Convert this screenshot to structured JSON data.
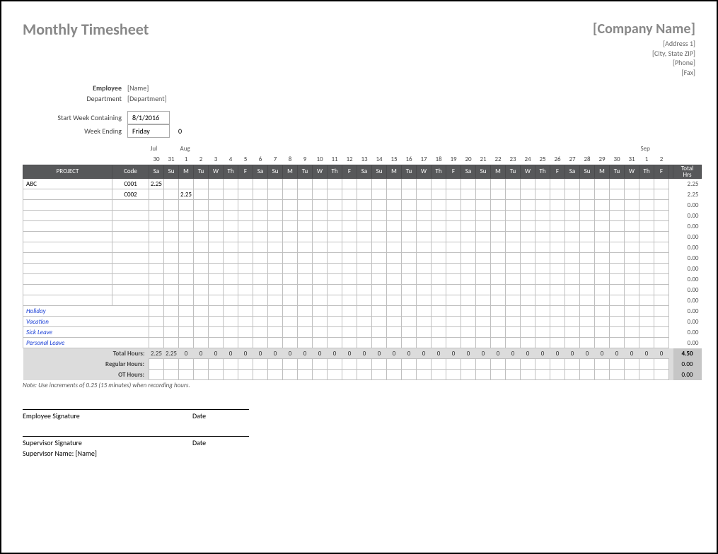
{
  "title": "Monthly Timesheet",
  "company": {
    "name": "[Company Name]",
    "addr1": "[Address 1]",
    "addr2": "[City, State ZIP]",
    "phone": "[Phone]",
    "fax": "[Fax]"
  },
  "meta": {
    "employee_label": "Employee",
    "employee": "[Name]",
    "department_label": "Department",
    "department": "[Department]",
    "start_label": "Start Week Containing",
    "start_value": "8/1/2016",
    "weekend_label": "Week Ending",
    "weekend_day": "Friday",
    "weekend_num": "0"
  },
  "months": {
    "jul": "Jul",
    "aug": "Aug",
    "sep": "Sep"
  },
  "dates": [
    "30",
    "31",
    "1",
    "2",
    "3",
    "4",
    "5",
    "6",
    "7",
    "8",
    "9",
    "10",
    "11",
    "12",
    "13",
    "14",
    "15",
    "16",
    "17",
    "18",
    "19",
    "20",
    "21",
    "22",
    "23",
    "24",
    "25",
    "26",
    "27",
    "28",
    "29",
    "30",
    "31",
    "1",
    "2"
  ],
  "dow": [
    "Sa",
    "Su",
    "M",
    "Tu",
    "W",
    "Th",
    "F",
    "Sa",
    "Su",
    "M",
    "Tu",
    "W",
    "Th",
    "F",
    "Sa",
    "Su",
    "M",
    "Tu",
    "W",
    "Th",
    "F",
    "Sa",
    "Su",
    "M",
    "Tu",
    "W",
    "Th",
    "F",
    "Sa",
    "Su",
    "M",
    "Tu",
    "W",
    "Th",
    "F"
  ],
  "headers": {
    "project": "PROJECT",
    "code": "Code",
    "total": "Total Hrs"
  },
  "rows": [
    {
      "project": "ABC",
      "code": "C001",
      "cells": {
        "0": "2.25"
      },
      "total": "2.25"
    },
    {
      "project": "",
      "code": "C002",
      "cells": {
        "2": "2.25"
      },
      "total": "2.25"
    },
    {
      "project": "",
      "code": "",
      "cells": {},
      "total": "0.00"
    },
    {
      "project": "",
      "code": "",
      "cells": {},
      "total": "0.00"
    },
    {
      "project": "",
      "code": "",
      "cells": {},
      "total": "0.00"
    },
    {
      "project": "",
      "code": "",
      "cells": {},
      "total": "0.00"
    },
    {
      "project": "",
      "code": "",
      "cells": {},
      "total": "0.00"
    },
    {
      "project": "",
      "code": "",
      "cells": {},
      "total": "0.00"
    },
    {
      "project": "",
      "code": "",
      "cells": {},
      "total": "0.00"
    },
    {
      "project": "",
      "code": "",
      "cells": {},
      "total": "0.00"
    },
    {
      "project": "",
      "code": "",
      "cells": {},
      "total": "0.00"
    },
    {
      "project": "",
      "code": "",
      "cells": {},
      "total": "0.00"
    }
  ],
  "blue_rows": [
    {
      "label": "Holiday",
      "total": "0.00"
    },
    {
      "label": "Vacation",
      "total": "0.00"
    },
    {
      "label": "Sick Leave",
      "total": "0.00"
    },
    {
      "label": "Personal Leave",
      "total": "0.00"
    }
  ],
  "totals": {
    "total_hours_label": "Total Hours:",
    "regular_label": "Regular Hours:",
    "ot_label": "OT Hours:",
    "total_hours": [
      "2.25",
      "2.25",
      "0",
      "0",
      "0",
      "0",
      "0",
      "0",
      "0",
      "0",
      "0",
      "0",
      "0",
      "0",
      "0",
      "0",
      "0",
      "0",
      "0",
      "0",
      "0",
      "0",
      "0",
      "0",
      "0",
      "0",
      "0",
      "0",
      "0",
      "0",
      "0",
      "0",
      "0",
      "0",
      "0"
    ],
    "grand_total": "4.50",
    "regular_total": "0.00",
    "ot_total": "0.00"
  },
  "note": "Note: Use increments of 0.25 (15 minutes) when recording hours.",
  "sig": {
    "emp_sig": "Employee Signature",
    "sup_sig": "Supervisor Signature",
    "date": "Date",
    "sup_name_label": "Supervisor Name:",
    "sup_name": "[Name]"
  }
}
